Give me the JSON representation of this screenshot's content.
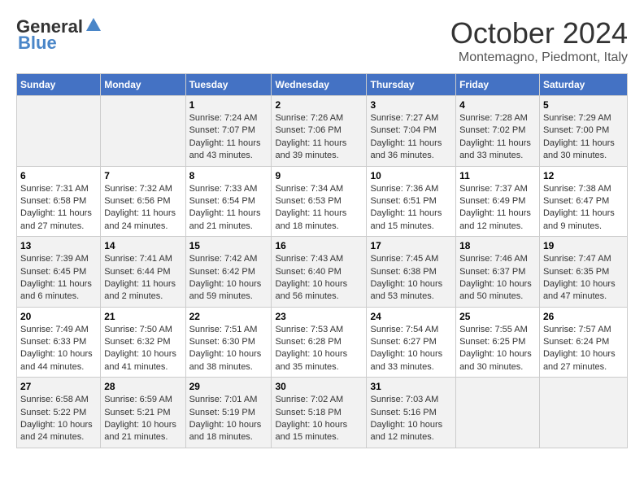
{
  "logo": {
    "general": "General",
    "blue": "Blue"
  },
  "title": "October 2024",
  "location": "Montemagno, Piedmont, Italy",
  "headers": [
    "Sunday",
    "Monday",
    "Tuesday",
    "Wednesday",
    "Thursday",
    "Friday",
    "Saturday"
  ],
  "weeks": [
    [
      {
        "day": "",
        "sunrise": "",
        "sunset": "",
        "daylight": ""
      },
      {
        "day": "",
        "sunrise": "",
        "sunset": "",
        "daylight": ""
      },
      {
        "day": "1",
        "sunrise": "Sunrise: 7:24 AM",
        "sunset": "Sunset: 7:07 PM",
        "daylight": "Daylight: 11 hours and 43 minutes."
      },
      {
        "day": "2",
        "sunrise": "Sunrise: 7:26 AM",
        "sunset": "Sunset: 7:06 PM",
        "daylight": "Daylight: 11 hours and 39 minutes."
      },
      {
        "day": "3",
        "sunrise": "Sunrise: 7:27 AM",
        "sunset": "Sunset: 7:04 PM",
        "daylight": "Daylight: 11 hours and 36 minutes."
      },
      {
        "day": "4",
        "sunrise": "Sunrise: 7:28 AM",
        "sunset": "Sunset: 7:02 PM",
        "daylight": "Daylight: 11 hours and 33 minutes."
      },
      {
        "day": "5",
        "sunrise": "Sunrise: 7:29 AM",
        "sunset": "Sunset: 7:00 PM",
        "daylight": "Daylight: 11 hours and 30 minutes."
      }
    ],
    [
      {
        "day": "6",
        "sunrise": "Sunrise: 7:31 AM",
        "sunset": "Sunset: 6:58 PM",
        "daylight": "Daylight: 11 hours and 27 minutes."
      },
      {
        "day": "7",
        "sunrise": "Sunrise: 7:32 AM",
        "sunset": "Sunset: 6:56 PM",
        "daylight": "Daylight: 11 hours and 24 minutes."
      },
      {
        "day": "8",
        "sunrise": "Sunrise: 7:33 AM",
        "sunset": "Sunset: 6:54 PM",
        "daylight": "Daylight: 11 hours and 21 minutes."
      },
      {
        "day": "9",
        "sunrise": "Sunrise: 7:34 AM",
        "sunset": "Sunset: 6:53 PM",
        "daylight": "Daylight: 11 hours and 18 minutes."
      },
      {
        "day": "10",
        "sunrise": "Sunrise: 7:36 AM",
        "sunset": "Sunset: 6:51 PM",
        "daylight": "Daylight: 11 hours and 15 minutes."
      },
      {
        "day": "11",
        "sunrise": "Sunrise: 7:37 AM",
        "sunset": "Sunset: 6:49 PM",
        "daylight": "Daylight: 11 hours and 12 minutes."
      },
      {
        "day": "12",
        "sunrise": "Sunrise: 7:38 AM",
        "sunset": "Sunset: 6:47 PM",
        "daylight": "Daylight: 11 hours and 9 minutes."
      }
    ],
    [
      {
        "day": "13",
        "sunrise": "Sunrise: 7:39 AM",
        "sunset": "Sunset: 6:45 PM",
        "daylight": "Daylight: 11 hours and 6 minutes."
      },
      {
        "day": "14",
        "sunrise": "Sunrise: 7:41 AM",
        "sunset": "Sunset: 6:44 PM",
        "daylight": "Daylight: 11 hours and 2 minutes."
      },
      {
        "day": "15",
        "sunrise": "Sunrise: 7:42 AM",
        "sunset": "Sunset: 6:42 PM",
        "daylight": "Daylight: 10 hours and 59 minutes."
      },
      {
        "day": "16",
        "sunrise": "Sunrise: 7:43 AM",
        "sunset": "Sunset: 6:40 PM",
        "daylight": "Daylight: 10 hours and 56 minutes."
      },
      {
        "day": "17",
        "sunrise": "Sunrise: 7:45 AM",
        "sunset": "Sunset: 6:38 PM",
        "daylight": "Daylight: 10 hours and 53 minutes."
      },
      {
        "day": "18",
        "sunrise": "Sunrise: 7:46 AM",
        "sunset": "Sunset: 6:37 PM",
        "daylight": "Daylight: 10 hours and 50 minutes."
      },
      {
        "day": "19",
        "sunrise": "Sunrise: 7:47 AM",
        "sunset": "Sunset: 6:35 PM",
        "daylight": "Daylight: 10 hours and 47 minutes."
      }
    ],
    [
      {
        "day": "20",
        "sunrise": "Sunrise: 7:49 AM",
        "sunset": "Sunset: 6:33 PM",
        "daylight": "Daylight: 10 hours and 44 minutes."
      },
      {
        "day": "21",
        "sunrise": "Sunrise: 7:50 AM",
        "sunset": "Sunset: 6:32 PM",
        "daylight": "Daylight: 10 hours and 41 minutes."
      },
      {
        "day": "22",
        "sunrise": "Sunrise: 7:51 AM",
        "sunset": "Sunset: 6:30 PM",
        "daylight": "Daylight: 10 hours and 38 minutes."
      },
      {
        "day": "23",
        "sunrise": "Sunrise: 7:53 AM",
        "sunset": "Sunset: 6:28 PM",
        "daylight": "Daylight: 10 hours and 35 minutes."
      },
      {
        "day": "24",
        "sunrise": "Sunrise: 7:54 AM",
        "sunset": "Sunset: 6:27 PM",
        "daylight": "Daylight: 10 hours and 33 minutes."
      },
      {
        "day": "25",
        "sunrise": "Sunrise: 7:55 AM",
        "sunset": "Sunset: 6:25 PM",
        "daylight": "Daylight: 10 hours and 30 minutes."
      },
      {
        "day": "26",
        "sunrise": "Sunrise: 7:57 AM",
        "sunset": "Sunset: 6:24 PM",
        "daylight": "Daylight: 10 hours and 27 minutes."
      }
    ],
    [
      {
        "day": "27",
        "sunrise": "Sunrise: 6:58 AM",
        "sunset": "Sunset: 5:22 PM",
        "daylight": "Daylight: 10 hours and 24 minutes."
      },
      {
        "day": "28",
        "sunrise": "Sunrise: 6:59 AM",
        "sunset": "Sunset: 5:21 PM",
        "daylight": "Daylight: 10 hours and 21 minutes."
      },
      {
        "day": "29",
        "sunrise": "Sunrise: 7:01 AM",
        "sunset": "Sunset: 5:19 PM",
        "daylight": "Daylight: 10 hours and 18 minutes."
      },
      {
        "day": "30",
        "sunrise": "Sunrise: 7:02 AM",
        "sunset": "Sunset: 5:18 PM",
        "daylight": "Daylight: 10 hours and 15 minutes."
      },
      {
        "day": "31",
        "sunrise": "Sunrise: 7:03 AM",
        "sunset": "Sunset: 5:16 PM",
        "daylight": "Daylight: 10 hours and 12 minutes."
      },
      {
        "day": "",
        "sunrise": "",
        "sunset": "",
        "daylight": ""
      },
      {
        "day": "",
        "sunrise": "",
        "sunset": "",
        "daylight": ""
      }
    ]
  ]
}
